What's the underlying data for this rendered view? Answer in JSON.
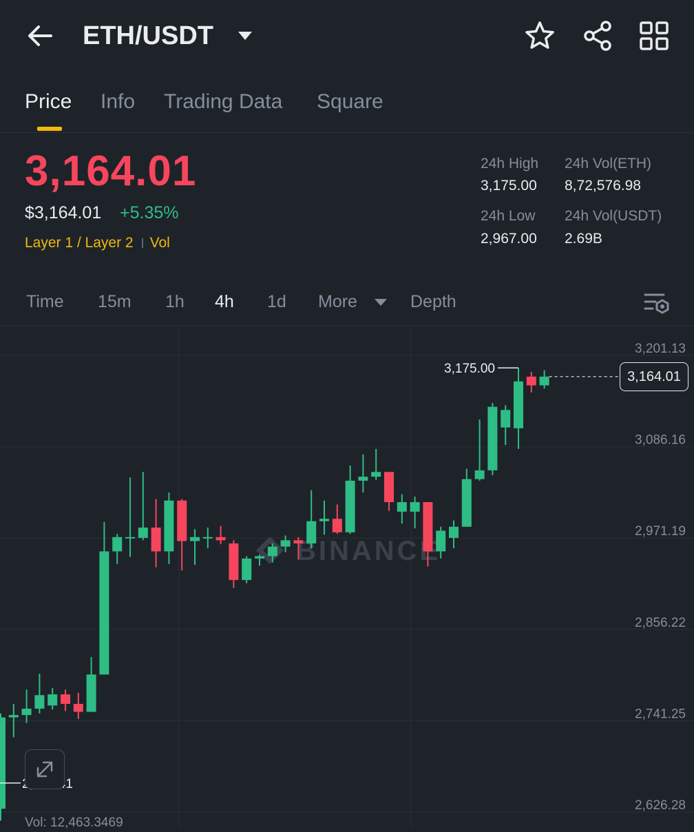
{
  "header": {
    "pair": "ETH/USDT",
    "icons": {
      "back": "arrow-left-icon",
      "caret": "caret-down-icon",
      "favorite": "star-icon",
      "share": "share-icon",
      "menu": "grid-icon"
    }
  },
  "tabs": [
    {
      "label": "Price",
      "active": true
    },
    {
      "label": "Info",
      "active": false
    },
    {
      "label": "Trading Data",
      "active": false
    },
    {
      "label": "Square",
      "active": false
    }
  ],
  "ticker": {
    "last_price": "3,164.01",
    "usd_price": "$3,164.01",
    "change_pct": "+5.35%",
    "tag_category": "Layer 1 / Layer 2",
    "tag_vol": "Vol",
    "stats": {
      "high_label": "24h High",
      "high_value": "3,175.00",
      "vol_base_label": "24h Vol(ETH)",
      "vol_base_value": "8,72,576.98",
      "low_label": "24h Low",
      "low_value": "2,967.00",
      "vol_quote_label": "24h Vol(USDT)",
      "vol_quote_value": "2.69B"
    }
  },
  "intervals": {
    "items": [
      "Time",
      "15m",
      "1h",
      "4h",
      "1d",
      "More",
      "Depth"
    ],
    "active": "4h",
    "settings_icon": "chart-settings-icon"
  },
  "colors": {
    "up": "#2ebd85",
    "down": "#f6465d",
    "accent": "#f0b90b",
    "background": "#1e2329"
  },
  "chart_data": {
    "type": "candlestick",
    "y_ticks": [
      "3,201.13",
      "3,086.16",
      "2,971.19",
      "2,856.22",
      "2,741.25",
      "2,626.28"
    ],
    "ylim": [
      2626.28,
      3201.13
    ],
    "watermark": "BINANCE",
    "high_marker": "3,175.00",
    "low_marker": "2,652.41",
    "current_price": "3,164.01",
    "candles": [
      {
        "o": 2620,
        "h": 2740,
        "l": 2605,
        "c": 2735
      },
      {
        "o": 2735,
        "h": 2752,
        "l": 2710,
        "c": 2738
      },
      {
        "o": 2738,
        "h": 2770,
        "l": 2728,
        "c": 2746
      },
      {
        "o": 2746,
        "h": 2790,
        "l": 2740,
        "c": 2763
      },
      {
        "o": 2750,
        "h": 2772,
        "l": 2745,
        "c": 2764
      },
      {
        "o": 2764,
        "h": 2770,
        "l": 2743,
        "c": 2752
      },
      {
        "o": 2752,
        "h": 2766,
        "l": 2733,
        "c": 2742
      },
      {
        "o": 2742,
        "h": 2811,
        "l": 2742,
        "c": 2789
      },
      {
        "o": 2789,
        "h": 2981,
        "l": 2789,
        "c": 2944
      },
      {
        "o": 2944,
        "h": 2966,
        "l": 2928,
        "c": 2962
      },
      {
        "o": 2962,
        "h": 3037,
        "l": 2937,
        "c": 2962
      },
      {
        "o": 2961,
        "h": 3044,
        "l": 2958,
        "c": 2974
      },
      {
        "o": 2974,
        "h": 3010,
        "l": 2924,
        "c": 2944
      },
      {
        "o": 2944,
        "h": 3018,
        "l": 2928,
        "c": 3008
      },
      {
        "o": 3008,
        "h": 3010,
        "l": 2920,
        "c": 2957
      },
      {
        "o": 2957,
        "h": 2972,
        "l": 2927,
        "c": 2962
      },
      {
        "o": 2962,
        "h": 2974,
        "l": 2948,
        "c": 2962
      },
      {
        "o": 2962,
        "h": 2976,
        "l": 2953,
        "c": 2958
      },
      {
        "o": 2954,
        "h": 2958,
        "l": 2898,
        "c": 2908
      },
      {
        "o": 2908,
        "h": 2938,
        "l": 2904,
        "c": 2935
      },
      {
        "o": 2935,
        "h": 2940,
        "l": 2926,
        "c": 2938
      },
      {
        "o": 2938,
        "h": 2954,
        "l": 2930,
        "c": 2950
      },
      {
        "o": 2950,
        "h": 2964,
        "l": 2943,
        "c": 2958
      },
      {
        "o": 2958,
        "h": 2962,
        "l": 2934,
        "c": 2954
      },
      {
        "o": 2954,
        "h": 3021,
        "l": 2948,
        "c": 2982
      },
      {
        "o": 2982,
        "h": 3008,
        "l": 2965,
        "c": 2985
      },
      {
        "o": 2985,
        "h": 3003,
        "l": 2966,
        "c": 2968
      },
      {
        "o": 2968,
        "h": 3052,
        "l": 2966,
        "c": 3033
      },
      {
        "o": 3033,
        "h": 3066,
        "l": 3018,
        "c": 3038
      },
      {
        "o": 3038,
        "h": 3073,
        "l": 3034,
        "c": 3044
      },
      {
        "o": 3044,
        "h": 3044,
        "l": 2995,
        "c": 3006
      },
      {
        "o": 2994,
        "h": 3016,
        "l": 2979,
        "c": 3006
      },
      {
        "o": 2994,
        "h": 3013,
        "l": 2973,
        "c": 3006
      },
      {
        "o": 3006,
        "h": 3006,
        "l": 2925,
        "c": 2944
      },
      {
        "o": 2944,
        "h": 2975,
        "l": 2935,
        "c": 2970
      },
      {
        "o": 2961,
        "h": 2983,
        "l": 2948,
        "c": 2975
      },
      {
        "o": 2975,
        "h": 3048,
        "l": 2976,
        "c": 3035
      },
      {
        "o": 3035,
        "h": 3110,
        "l": 3033,
        "c": 3046
      },
      {
        "o": 3046,
        "h": 3131,
        "l": 3040,
        "c": 3126
      },
      {
        "o": 3100,
        "h": 3128,
        "l": 3078,
        "c": 3122
      },
      {
        "o": 3099,
        "h": 3175,
        "l": 3073,
        "c": 3158
      },
      {
        "o": 3164,
        "h": 3170,
        "l": 3144,
        "c": 3153
      },
      {
        "o": 3153,
        "h": 3172,
        "l": 3149,
        "c": 3164
      }
    ]
  },
  "volume_line": "Vol: 12,463.3469"
}
